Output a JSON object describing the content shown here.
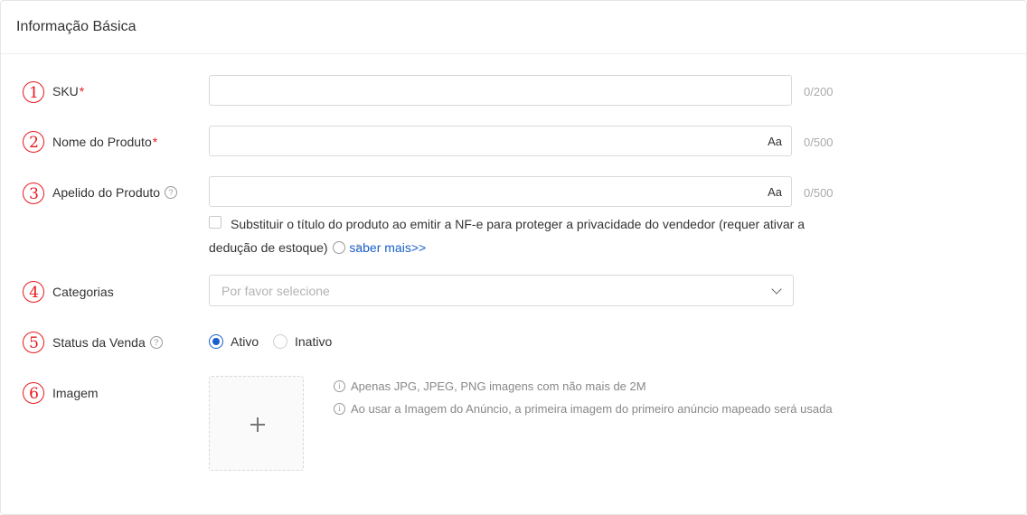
{
  "section": {
    "title": "Informação Básica"
  },
  "markers": [
    "1",
    "2",
    "3",
    "4",
    "5",
    "6"
  ],
  "fields": {
    "sku": {
      "label": "SKU",
      "required": "*",
      "value": "",
      "counter": "0/200"
    },
    "product_name": {
      "label": "Nome do Produto",
      "required": "*",
      "value": "",
      "case_toggle": "Aa",
      "counter": "0/500"
    },
    "product_alias": {
      "label": "Apelido do Produto",
      "help_icon": "question-circle-icon",
      "value": "",
      "case_toggle": "Aa",
      "counter": "0/500",
      "checkbox_text": "Substituir o título do produto ao emitir a NF-e para proteger a privacidade do vendedor (requer ativar a dedução de estoque)",
      "checkbox_link": "saber mais>>",
      "checkbox_checked": false
    },
    "categories": {
      "label": "Categorias",
      "placeholder": "Por favor selecione",
      "icon": "chevron-down-icon"
    },
    "sale_status": {
      "label": "Status da Venda",
      "help_icon": "question-circle-icon",
      "options": [
        "Ativo",
        "Inativo"
      ],
      "selected": "Ativo"
    },
    "image": {
      "label": "Imagem",
      "upload_icon": "plus-icon",
      "hints": [
        "Apenas JPG, JPEG, PNG imagens com não mais de 2M",
        "Ao usar a Imagem do Anúncio, a primeira imagem do primeiro anúncio mapeado será usada"
      ]
    }
  },
  "colors": {
    "required": "#e6191e",
    "link": "#1a5fcc",
    "marker": "#e6191e"
  }
}
